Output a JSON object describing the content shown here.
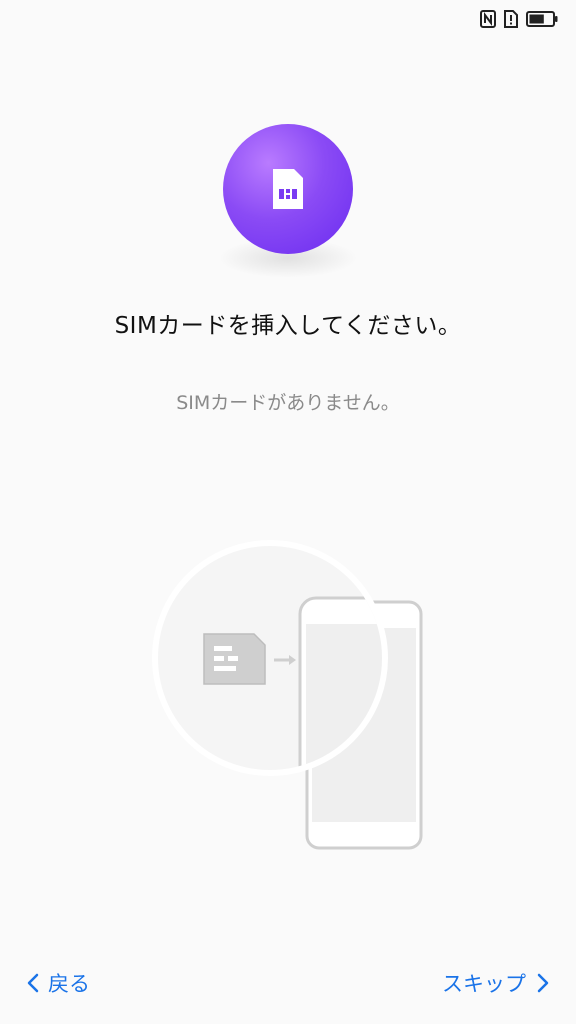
{
  "status_bar": {
    "icons": [
      "nfc-icon",
      "sim-alert-icon",
      "battery-icon"
    ],
    "battery_level": 0.65
  },
  "hero": {
    "icon": "sim-card-icon",
    "gradient_colors": [
      "#b97bff",
      "#8b4bf5",
      "#6a2bf0"
    ]
  },
  "main": {
    "title": "SIMカードを挿入してください。",
    "subtitle": "SIMカードがありません。"
  },
  "illustration": {
    "icons": [
      "sim-card-icon",
      "arrow-right-icon",
      "phone-icon"
    ]
  },
  "nav": {
    "back_label": "戻る",
    "skip_label": "スキップ",
    "accent_color": "#1a73e8"
  }
}
